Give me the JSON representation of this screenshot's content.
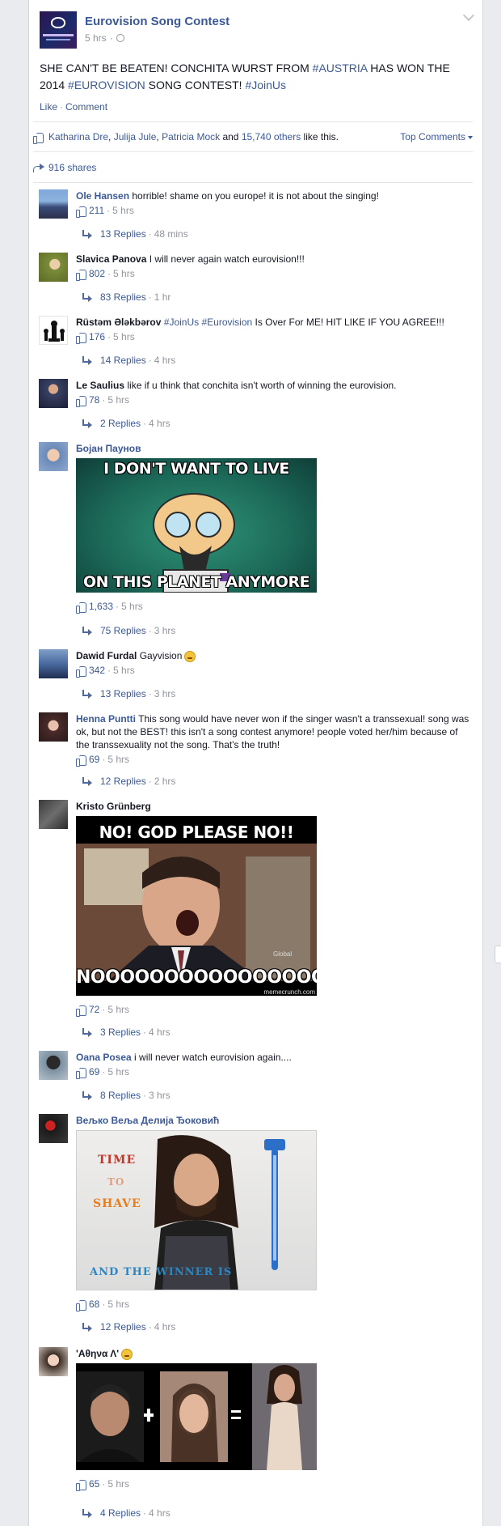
{
  "post": {
    "page_name": "Eurovision Song Contest",
    "time": "5 hrs",
    "text_parts": {
      "a": "SHE CAN'T BE BEATEN! CONCHITA WURST FROM ",
      "tag1": "#AUSTRIA",
      "b": " HAS WON THE 2014 ",
      "tag2": "#EUROVISION",
      "c": " SONG CONTEST! ",
      "tag3": "#JoinUs"
    },
    "actions": {
      "like": "Like",
      "comment": "Comment"
    },
    "likes": {
      "name1": "Katharina Dre",
      "name2": "Julija Jule",
      "name3": "Patricia Mock",
      "and": " and ",
      "others": "15,740 others",
      "suffix": " like this."
    },
    "top_comments": "Top Comments",
    "shares": "916 shares"
  },
  "comments": [
    {
      "name": "Ole Hansen",
      "text": "horrible! shame on you europe! it is not about the singing!",
      "likes": "211",
      "time": "5 hrs",
      "replies": "13 Replies",
      "reply_time": "48 mins"
    },
    {
      "name": "Slavica Panova",
      "text": "I will never again watch eurovision!!!",
      "likes": "802",
      "time": "5 hrs",
      "replies": "83 Replies",
      "reply_time": "1 hr"
    },
    {
      "name": "Rüstəm Ələkbərov",
      "tag1": "#JoinUs",
      "tag2": "#Eurovision",
      "text": "Is Over For ME! HIT LIKE IF YOU AGREE!!!",
      "likes": "176",
      "time": "5 hrs",
      "replies": "14 Replies",
      "reply_time": "4 hrs"
    },
    {
      "name": "Le Saulius",
      "text": "like if u think that conchita isn't worth of winning the eurovision.",
      "likes": "78",
      "time": "5 hrs",
      "replies": "2 Replies",
      "reply_time": "4 hrs"
    },
    {
      "name": "Бојан Паунов",
      "meme_top": "I DON'T WANT TO LIVE",
      "meme_bottom": "ON THIS PLANET ANYMORE",
      "likes": "1,633",
      "time": "5 hrs",
      "replies": "75 Replies",
      "reply_time": "3 hrs"
    },
    {
      "name": "Dawid Furdal",
      "text": "Gayvision",
      "likes": "342",
      "time": "5 hrs",
      "replies": "13 Replies",
      "reply_time": "3 hrs"
    },
    {
      "name": "Henna Puntti",
      "text": "This song would have never won if the singer wasn't a transsexual! song was ok, but not the BEST! this isn't a song contest anymore! people voted her/him because of the transsexuality not the song. That's the truth!",
      "likes": "69",
      "time": "5 hrs",
      "replies": "12 Replies",
      "reply_time": "2 hrs"
    },
    {
      "name": "Kristo Grünberg",
      "meme_top": "NO! GOD PLEASE NO!!",
      "meme_bottom": "NOOOOOOOOOOOOOOOO",
      "meme_credit": "memecrunch.com",
      "meme_small": "Global",
      "likes": "72",
      "time": "5 hrs",
      "replies": "3 Replies",
      "reply_time": "4 hrs"
    },
    {
      "name": "Oana Posea",
      "text": "i will never watch eurovision again....",
      "likes": "69",
      "time": "5 hrs",
      "replies": "8 Replies",
      "reply_time": "3 hrs"
    },
    {
      "name": "Вељко Веља Делија Ђоковић",
      "meme_lines": [
        "TIME",
        "TO",
        "SHAVE"
      ],
      "meme_bottom": "AND THE WINNER IS",
      "likes": "68",
      "time": "5 hrs",
      "replies": "12 Replies",
      "reply_time": "4 hrs"
    },
    {
      "name": "'Αθηνα Λ'",
      "likes": "65",
      "time": "5 hrs",
      "replies": "4 Replies",
      "reply_time": "4 hrs"
    }
  ],
  "sep": "·"
}
